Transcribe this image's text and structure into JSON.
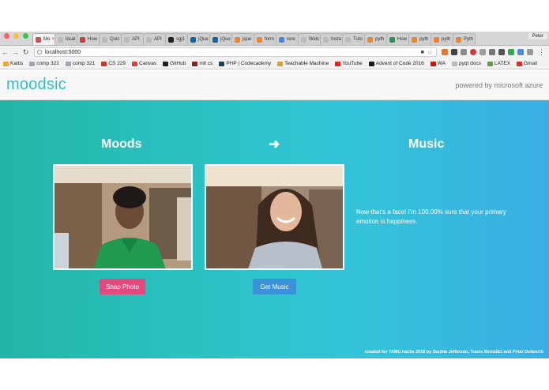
{
  "browser": {
    "tabs": [
      {
        "label": "Mo",
        "icon": "moodsic-favicon",
        "active": true
      },
      {
        "label": "local",
        "icon": "page-icon"
      },
      {
        "label": "How",
        "icon": "red-square-icon"
      },
      {
        "label": "Quic",
        "icon": "page-icon"
      },
      {
        "label": "API",
        "icon": "page-icon"
      },
      {
        "label": "API",
        "icon": "page-icon"
      },
      {
        "label": "sgj1",
        "icon": "github-icon"
      },
      {
        "label": "jQue",
        "icon": "jquery-icon"
      },
      {
        "label": "jQue",
        "icon": "jquery-icon"
      },
      {
        "label": "jque",
        "icon": "stackoverflow-icon"
      },
      {
        "label": "form",
        "icon": "stackoverflow-icon"
      },
      {
        "label": "rere",
        "icon": "google-icon"
      },
      {
        "label": "Welc",
        "icon": "page-icon"
      },
      {
        "label": "Insta",
        "icon": "page-icon"
      },
      {
        "label": "Tuto",
        "icon": "page-icon"
      },
      {
        "label": "pyth",
        "icon": "stackoverflow-icon"
      },
      {
        "label": "How",
        "icon": "green-square-icon"
      },
      {
        "label": "pyth",
        "icon": "stackoverflow-icon"
      },
      {
        "label": "pyth",
        "icon": "stackoverflow-icon"
      },
      {
        "label": "Pyth",
        "icon": "stackoverflow-icon"
      }
    ],
    "user": "Peter",
    "url": "localhost:5000",
    "bookmarks": [
      {
        "label": "Kattis",
        "icon": "kattis-icon"
      },
      {
        "label": "comp 322",
        "icon": "folder-icon"
      },
      {
        "label": "comp 321",
        "icon": "folder-icon"
      },
      {
        "label": "CS 229",
        "icon": "cs-icon"
      },
      {
        "label": "Canvas",
        "icon": "canvas-icon"
      },
      {
        "label": "GitHub",
        "icon": "github-icon"
      },
      {
        "label": "mit cs",
        "icon": "mit-icon"
      },
      {
        "label": "PHP | Codecademy",
        "icon": "codecademy-icon"
      },
      {
        "label": "Teachable Machine",
        "icon": "teachable-icon"
      },
      {
        "label": "YouTube",
        "icon": "youtube-icon"
      },
      {
        "label": "Advent of Code 2016",
        "icon": "star-icon"
      },
      {
        "label": "WA",
        "icon": "wolfram-icon"
      },
      {
        "label": "pyqt docs",
        "icon": "page-icon"
      },
      {
        "label": "LATEX",
        "icon": "latex-icon"
      },
      {
        "label": "Gmail",
        "icon": "gmail-icon"
      }
    ]
  },
  "app": {
    "logo": "moodsic",
    "powered_by": "powered by microsoft azure",
    "moods_heading": "Moods",
    "arrow": "➜",
    "music_heading": "Music",
    "snap_button": "Snap Photo",
    "get_music_button": "Get Music",
    "result_text": "Now that's a face! I'm 100.00% sure that your primary emotion is happiness.",
    "credits": "created for TAMU hacks 2018 by Sophia Jefferson, Travis Benedict and Peter Dulworth"
  },
  "colors": {
    "brand": "#2fbfc6",
    "snap_button": "#e24a7d",
    "music_button": "#3a93d8"
  }
}
